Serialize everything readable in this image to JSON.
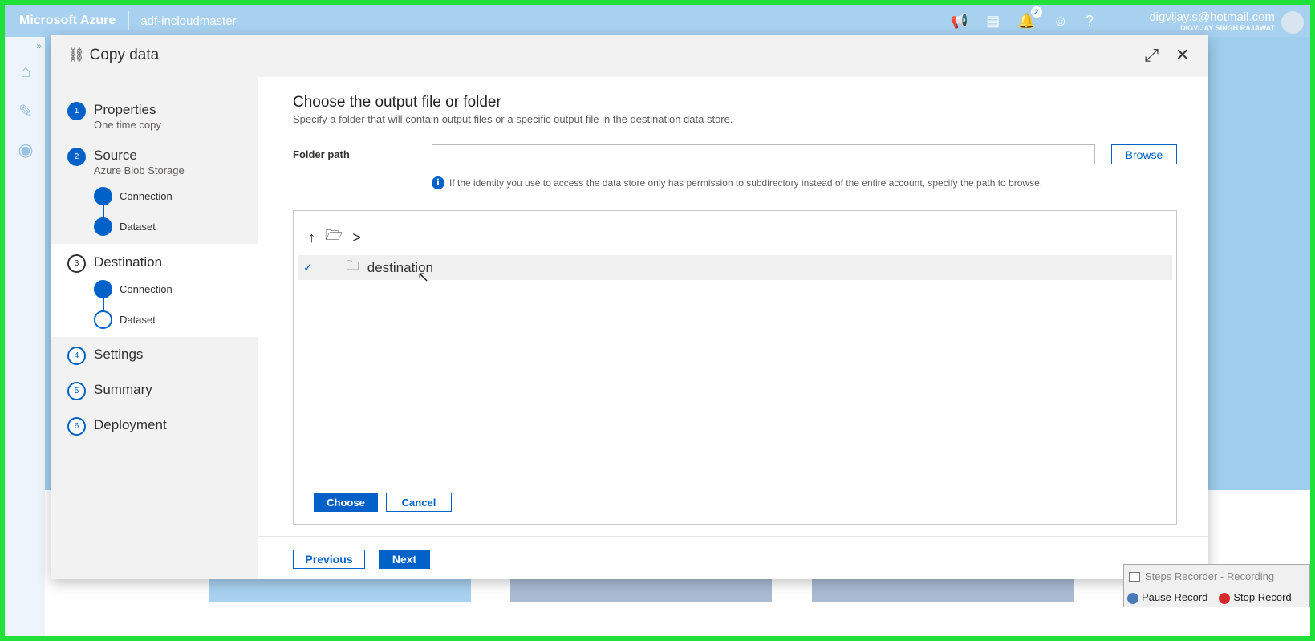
{
  "topbar": {
    "brand": "Microsoft Azure",
    "factory": "adf-incloudmaster",
    "notification_count": "2",
    "user_email": "digvijay.s@hotmail.com",
    "user_name": "DIGVIJAY SINGH RAJAWAT",
    "help": "?"
  },
  "dialog": {
    "title": "Copy data"
  },
  "steps": [
    {
      "num": "1",
      "label": "Properties",
      "sub": "One time copy"
    },
    {
      "num": "2",
      "label": "Source",
      "sub": "Azure Blob Storage",
      "children": [
        "Connection",
        "Dataset"
      ]
    },
    {
      "num": "3",
      "label": "Destination",
      "children": [
        "Connection",
        "Dataset"
      ]
    },
    {
      "num": "4",
      "label": "Settings"
    },
    {
      "num": "5",
      "label": "Summary"
    },
    {
      "num": "6",
      "label": "Deployment"
    }
  ],
  "main": {
    "title": "Choose the output file or folder",
    "description": "Specify a folder that will contain output files or a specific output file in the destination data store.",
    "folder_path_label": "Folder path",
    "folder_path_value": "",
    "browse_label": "Browse",
    "info_text": "If the identity you use to access the data store only has permission to subdirectory instead of the entire account, specify the path to browse.",
    "breadcrumb_sep": ">",
    "items": [
      {
        "name": "destination",
        "selected": true
      }
    ],
    "choose_label": "Choose",
    "cancel_label": "Cancel"
  },
  "footer": {
    "previous_label": "Previous",
    "next_label": "Next"
  },
  "recorder": {
    "title": "Steps Recorder - Recording",
    "pause_label": "Pause Record",
    "stop_label": "Stop Record"
  },
  "colors": {
    "accent": "#0062c8",
    "topbar": "#a8d1f0",
    "frame": "#22e03a"
  }
}
